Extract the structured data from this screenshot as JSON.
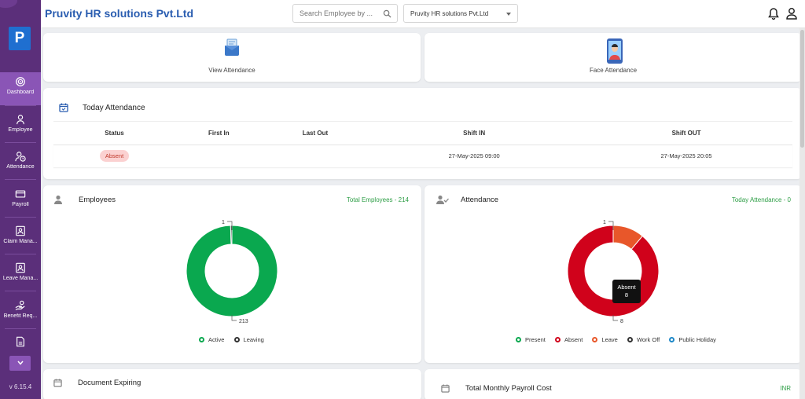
{
  "sidebar": {
    "logo_letter": "P",
    "items": [
      {
        "label": "Dashboard",
        "icon": "dashboard-icon",
        "active": true
      },
      {
        "label": "Employee",
        "icon": "person-icon"
      },
      {
        "label": "Attendance",
        "icon": "attendance-icon"
      },
      {
        "label": "Payroll",
        "icon": "payroll-icon"
      },
      {
        "label": "Claim Mana...",
        "icon": "claim-icon"
      },
      {
        "label": "Leave Mana...",
        "icon": "leave-icon"
      },
      {
        "label": "Benefit Req...",
        "icon": "benefit-icon"
      },
      {
        "label": "",
        "icon": "document-icon"
      }
    ],
    "version": "v 6.15.4"
  },
  "header": {
    "title": "Pruvity HR solutions Pvt.Ltd",
    "search_placeholder": "Search Employee by ...",
    "company_select": "Pruvity HR solutions Pvt.Ltd"
  },
  "quick_actions": [
    {
      "label": "View Attendance",
      "icon": "view-attendance-icon"
    },
    {
      "label": "Face Attendance",
      "icon": "face-attendance-icon"
    }
  ],
  "today_attendance": {
    "title": "Today Attendance",
    "columns": [
      "Status",
      "First In",
      "Last Out",
      "Shift IN",
      "Shift OUT"
    ],
    "row": {
      "status": "Absent",
      "first_in": "",
      "last_out": "",
      "shift_in": "27-May-2025 09:00",
      "shift_out": "27-May-2025 20:05"
    }
  },
  "employees_card": {
    "title": "Employees",
    "total": "Total Employees - 214",
    "label_top": "1",
    "label_bottom": "213",
    "legend": [
      {
        "label": "Active",
        "color": "#0aa84f"
      },
      {
        "label": "Leaving",
        "color": "#333333"
      }
    ]
  },
  "attendance_card": {
    "title": "Attendance",
    "total": "Today Attendance - 0",
    "label_top": "1",
    "label_bottom": "8",
    "tooltip_title": "Absent",
    "tooltip_value": "8",
    "legend": [
      {
        "label": "Present",
        "color": "#0aa84f"
      },
      {
        "label": "Absent",
        "color": "#d0021b"
      },
      {
        "label": "Leave",
        "color": "#e8572a"
      },
      {
        "label": "Work Off",
        "color": "#333333"
      },
      {
        "label": "Public Holiday",
        "color": "#1e88c8"
      }
    ]
  },
  "document_card": {
    "title": "Document Expiring"
  },
  "payroll_card": {
    "title": "Total Monthly Payroll Cost",
    "currency": "INR"
  },
  "chart_data": [
    {
      "type": "pie",
      "categories": [
        "Active",
        "Leaving"
      ],
      "values": [
        213,
        1
      ]
    },
    {
      "type": "pie",
      "categories": [
        "Present",
        "Absent",
        "Leave",
        "Work Off",
        "Public Holiday"
      ],
      "values": [
        0,
        8,
        1,
        0,
        0
      ]
    }
  ],
  "colors": {
    "sidebar": "#5b2f7a",
    "active_nav": "#8a55b6",
    "brand_title": "#2a5db0",
    "green": "#0aa84f",
    "red": "#d0021b",
    "orange": "#e8572a"
  }
}
